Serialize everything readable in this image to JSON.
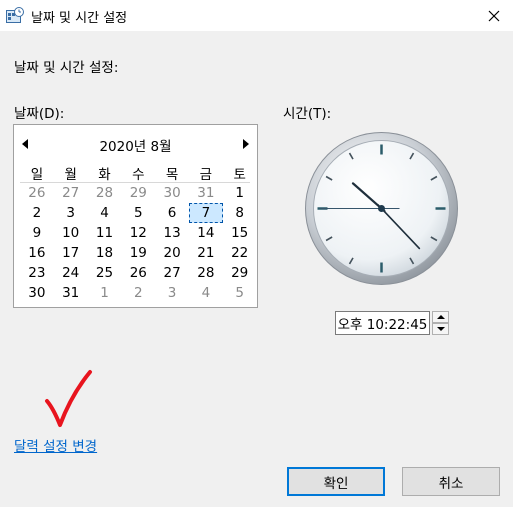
{
  "window": {
    "title": "날짜 및 시간 설정"
  },
  "heading": "날짜 및 시간 설정:",
  "date_label": "날짜(D):",
  "time_label": "시간(T):",
  "calendar": {
    "month_title": "2020년 8월",
    "weekdays": [
      "일",
      "월",
      "화",
      "수",
      "목",
      "금",
      "토"
    ],
    "weeks": [
      [
        "26",
        "27",
        "28",
        "29",
        "30",
        "31",
        "1"
      ],
      [
        "2",
        "3",
        "4",
        "5",
        "6",
        "7",
        "8"
      ],
      [
        "9",
        "10",
        "11",
        "12",
        "13",
        "14",
        "15"
      ],
      [
        "16",
        "17",
        "18",
        "19",
        "20",
        "21",
        "22"
      ],
      [
        "23",
        "24",
        "25",
        "26",
        "27",
        "28",
        "29"
      ],
      [
        "30",
        "31",
        "1",
        "2",
        "3",
        "4",
        "5"
      ]
    ],
    "selected_day": "7"
  },
  "clock": {
    "hour": 10,
    "minute": 22,
    "second": 45
  },
  "time_value": "오후 10:22:45",
  "link_text": "달력 설정 변경",
  "buttons": {
    "ok": "확인",
    "cancel": "취소"
  },
  "colors": {
    "accent": "#0078d7",
    "link": "#0066cc",
    "selection": "#cce8ff",
    "annotation": "#e8141e"
  }
}
